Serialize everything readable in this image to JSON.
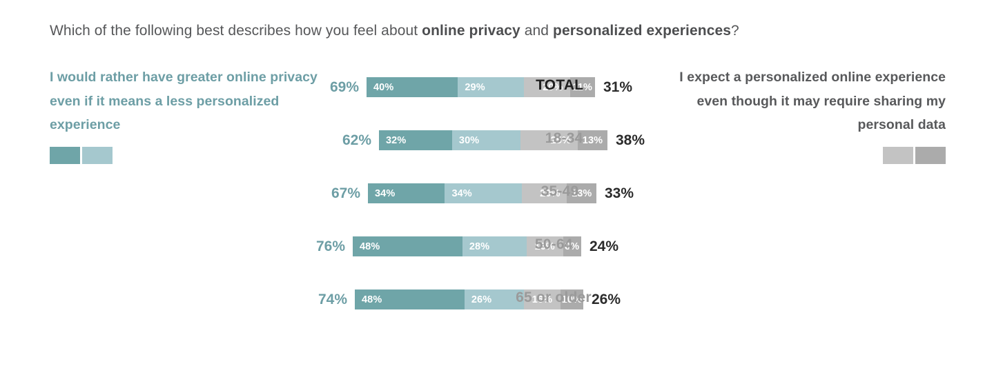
{
  "title": {
    "part1": "Which of the following best describes how you feel about ",
    "bold1": "online privacy",
    "part2": " and ",
    "bold2": "personalized experiences",
    "part3": "?"
  },
  "legend_left": {
    "text": "I would rather have greater online privacy even if it means a less personalized experience",
    "color": "#6d9ea5",
    "swatch_1_color": "#6fa5a8",
    "swatch_2_color": "#a5c8ce"
  },
  "legend_right": {
    "text": "I expect a personalized online experience even though it may require sharing my personal data",
    "color": "#58595b",
    "swatch_1_color": "#c3c3c3",
    "swatch_2_color": "#ababab"
  },
  "chart_data": {
    "type": "bar",
    "subtype": "diverging-stacked-bar",
    "title": "Which of the following best describes how you feel about online privacy and personalized experiences?",
    "xlabel": "",
    "ylabel": "",
    "xlim": [
      0,
      100
    ],
    "grid": false,
    "legend_position": "sides",
    "categories": [
      "TOTAL",
      "18-34",
      "35-49",
      "50-64",
      "65 or older"
    ],
    "series": [
      {
        "name": "I would rather have greater online privacy even if it means a less personalized experience (strongly)",
        "color": "#6fa5a8",
        "values": [
          40,
          32,
          34,
          48,
          48
        ]
      },
      {
        "name": "I would rather have greater online privacy even if it means a less personalized experience (somewhat)",
        "color": "#a5c8ce",
        "values": [
          29,
          30,
          34,
          28,
          26
        ]
      },
      {
        "name": "I expect a personalized online experience even though it may require sharing my personal data (somewhat)",
        "color": "#c3c3c3",
        "values": [
          20,
          25,
          20,
          16,
          16
        ]
      },
      {
        "name": "I expect a personalized online experience even though it may require sharing my personal data (strongly)",
        "color": "#ababab",
        "values": [
          11,
          13,
          13,
          8,
          10
        ]
      }
    ],
    "net_left": [
      69,
      62,
      67,
      76,
      74
    ],
    "net_right": [
      31,
      38,
      33,
      24,
      26
    ]
  },
  "rows": [
    {
      "category": "TOTAL",
      "is_total": true,
      "net_left": "69%",
      "net_right": "31%",
      "segments": [
        {
          "label": "40%",
          "value": 40,
          "color": "#6fa5a8",
          "align": "align-left"
        },
        {
          "label": "29%",
          "value": 29,
          "color": "#a5c8ce",
          "align": "align-left"
        },
        {
          "label": "20%",
          "value": 20,
          "color": "#c3c3c3",
          "align": "align-right"
        },
        {
          "label": "11%",
          "value": 11,
          "color": "#ababab",
          "align": "align-center"
        }
      ]
    },
    {
      "category": "18-34",
      "is_total": false,
      "net_left": "62%",
      "net_right": "38%",
      "segments": [
        {
          "label": "32%",
          "value": 32,
          "color": "#6fa5a8",
          "align": "align-left"
        },
        {
          "label": "30%",
          "value": 30,
          "color": "#a5c8ce",
          "align": "align-left"
        },
        {
          "label": "25%",
          "value": 25,
          "color": "#c3c3c3",
          "align": "align-right"
        },
        {
          "label": "13%",
          "value": 13,
          "color": "#ababab",
          "align": "align-center"
        }
      ]
    },
    {
      "category": "35-49",
      "is_total": false,
      "net_left": "67%",
      "net_right": "33%",
      "segments": [
        {
          "label": "34%",
          "value": 34,
          "color": "#6fa5a8",
          "align": "align-left"
        },
        {
          "label": "34%",
          "value": 34,
          "color": "#a5c8ce",
          "align": "align-left"
        },
        {
          "label": "20%",
          "value": 20,
          "color": "#c3c3c3",
          "align": "align-right"
        },
        {
          "label": "13%",
          "value": 13,
          "color": "#ababab",
          "align": "align-center"
        }
      ]
    },
    {
      "category": "50-64",
      "is_total": false,
      "net_left": "76%",
      "net_right": "24%",
      "segments": [
        {
          "label": "48%",
          "value": 48,
          "color": "#6fa5a8",
          "align": "align-left"
        },
        {
          "label": "28%",
          "value": 28,
          "color": "#a5c8ce",
          "align": "align-left"
        },
        {
          "label": "16%",
          "value": 16,
          "color": "#c3c3c3",
          "align": "align-center"
        },
        {
          "label": "8%",
          "value": 8,
          "color": "#ababab",
          "align": "align-center"
        }
      ]
    },
    {
      "category": "65 or older",
      "is_total": false,
      "net_left": "74%",
      "net_right": "26%",
      "segments": [
        {
          "label": "48%",
          "value": 48,
          "color": "#6fa5a8",
          "align": "align-left"
        },
        {
          "label": "26%",
          "value": 26,
          "color": "#a5c8ce",
          "align": "align-left"
        },
        {
          "label": "16%",
          "value": 16,
          "color": "#c3c3c3",
          "align": "align-center"
        },
        {
          "label": "10%",
          "value": 10,
          "color": "#ababab",
          "align": "align-center"
        }
      ]
    }
  ]
}
